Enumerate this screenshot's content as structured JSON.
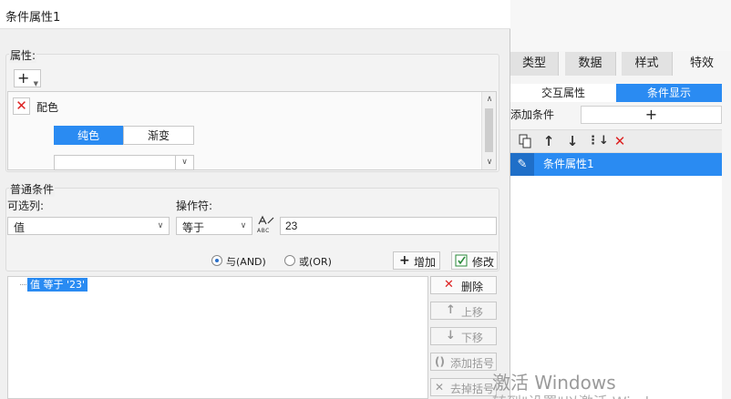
{
  "dialog": {
    "title": "条件属性1",
    "properties": {
      "label": "属性:",
      "add_button": "+",
      "item_label": "配色",
      "segment": [
        "纯色",
        "渐变"
      ]
    },
    "common": {
      "group_label": "普通条件",
      "column_label": "可选列:",
      "column_value": "值",
      "operator_label": "操作符:",
      "operator_value": "等于",
      "value_input": "23",
      "formula_icon_text": "ABC"
    },
    "logic": {
      "and_label": "与(AND)",
      "or_label": "或(OR)",
      "selected": "and"
    },
    "buttons": {
      "add": "增加",
      "modify": "修改",
      "delete": "删除",
      "up": "上移",
      "down": "下移",
      "add_bracket": "添加括号",
      "remove_bracket": "去掉括号"
    },
    "conditions": [
      "值 等于 '23'"
    ]
  },
  "right_panel": {
    "tabs": [
      "类型",
      "数据",
      "样式",
      "特效"
    ],
    "active_tab": "特效",
    "segments": [
      "交互属性",
      "条件显示"
    ],
    "active_segment": "条件显示",
    "add_condition_label": "添加条件",
    "add_condition_button": "+",
    "list_items": [
      "条件属性1"
    ]
  },
  "watermark": {
    "line1": "激活 Windows",
    "line2": "转到\"设置\"以激活 Windows。"
  },
  "colors": {
    "accent": "#2a8bf2",
    "delete_red": "#dd2222"
  }
}
